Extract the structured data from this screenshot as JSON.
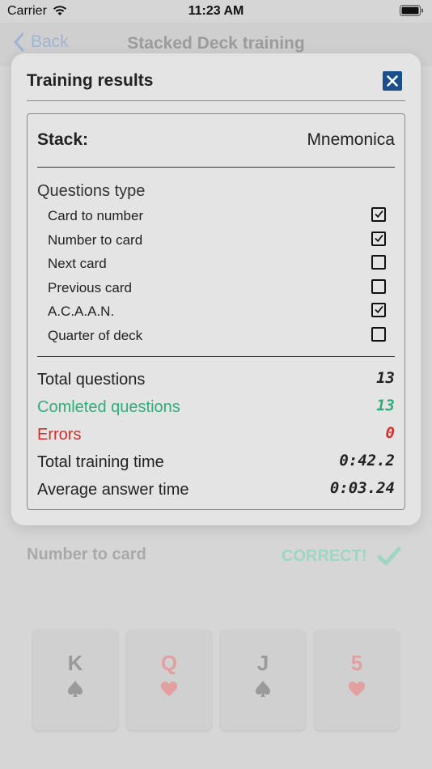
{
  "status_bar": {
    "carrier": "Carrier",
    "time": "11:23 AM"
  },
  "nav": {
    "back_label": "Back",
    "title": "Stacked Deck training"
  },
  "background": {
    "question_type": "Number to card",
    "result": "CORRECT!",
    "cards": [
      {
        "rank": "K",
        "suit": "spade"
      },
      {
        "rank": "Q",
        "suit": "heart"
      },
      {
        "rank": "J",
        "suit": "spade"
      },
      {
        "rank": "5",
        "suit": "heart"
      }
    ]
  },
  "modal": {
    "title": "Training results",
    "stack_label": "Stack:",
    "stack_value": "Mnemonica",
    "questions_type_heading": "Questions type",
    "question_types": [
      {
        "label": "Card to number",
        "checked": true
      },
      {
        "label": "Number to card",
        "checked": true
      },
      {
        "label": "Next card",
        "checked": false
      },
      {
        "label": "Previous card",
        "checked": false
      },
      {
        "label": "A.C.A.A.N.",
        "checked": true
      },
      {
        "label": "Quarter of deck",
        "checked": false
      }
    ],
    "stats": [
      {
        "label": "Total questions",
        "value": "13"
      },
      {
        "label": "Comleted questions",
        "value": "13"
      },
      {
        "label": "Errors",
        "value": "0"
      },
      {
        "label": "Total training time",
        "value": "0:42.2"
      },
      {
        "label": "Average answer time",
        "value": "0:03.24"
      }
    ]
  },
  "colors": {
    "accent": "#1b4f8c",
    "success": "#2fae7a",
    "error": "#d0302c"
  }
}
